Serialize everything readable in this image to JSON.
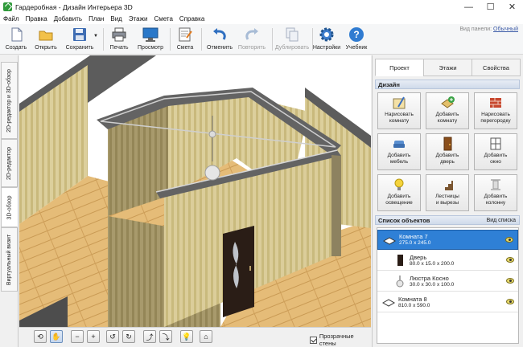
{
  "window": {
    "title": "Гардеробная - Дизайн Интерьера 3D",
    "minimize": "—",
    "maximize": "☐",
    "close": "✕"
  },
  "menu": [
    "Файл",
    "Правка",
    "Добавить",
    "План",
    "Вид",
    "Этажи",
    "Смета",
    "Справка"
  ],
  "toolbar": {
    "create": "Создать",
    "open": "Открыть",
    "save": "Сохранить",
    "print": "Печать",
    "preview": "Просмотр",
    "estimate": "Смета",
    "undo": "Отменить",
    "redo": "Повторить",
    "duplicate": "Дублировать",
    "settings": "Настройки",
    "tutorial": "Учебник",
    "panel_view_label": "Вид панели:",
    "panel_view_value": "Обычный"
  },
  "left_tabs": [
    "2D-редактор и 3D-обзор",
    "2D-редактор",
    "3D-обзор",
    "Виртуальный визит"
  ],
  "right_tabs": [
    "Проект",
    "Этажи",
    "Свойства"
  ],
  "design": {
    "header": "Дизайн",
    "buttons": [
      [
        "Нарисовать",
        "комнату"
      ],
      [
        "Добавить",
        "комнату"
      ],
      [
        "Нарисовать",
        "перегородку"
      ],
      [
        "Добавить",
        "мебель"
      ],
      [
        "Добавить",
        "дверь"
      ],
      [
        "Добавить",
        "окно"
      ],
      [
        "Добавить",
        "освещение"
      ],
      [
        "Лестницы",
        "и вырезы"
      ],
      [
        "Добавить",
        "колонну"
      ]
    ]
  },
  "objects": {
    "header": "Список объектов",
    "view_list": "Вид списка",
    "items": [
      {
        "name": "Комната 7",
        "dims": "275.0 x 245.0"
      },
      {
        "name": "Дверь",
        "dims": "80.0 x 15.0 x 200.0"
      },
      {
        "name": "Люстра Косно",
        "dims": "30.0 x 30.0 x 100.0"
      },
      {
        "name": "Комната 8",
        "dims": "810.0 x 590.0"
      }
    ]
  },
  "bottom": {
    "transparent_walls": "Прозрачные стены"
  },
  "colors": {
    "accent": "#2f80d6",
    "floor": "#e2b873",
    "wall_top": "#6a6a6a"
  }
}
